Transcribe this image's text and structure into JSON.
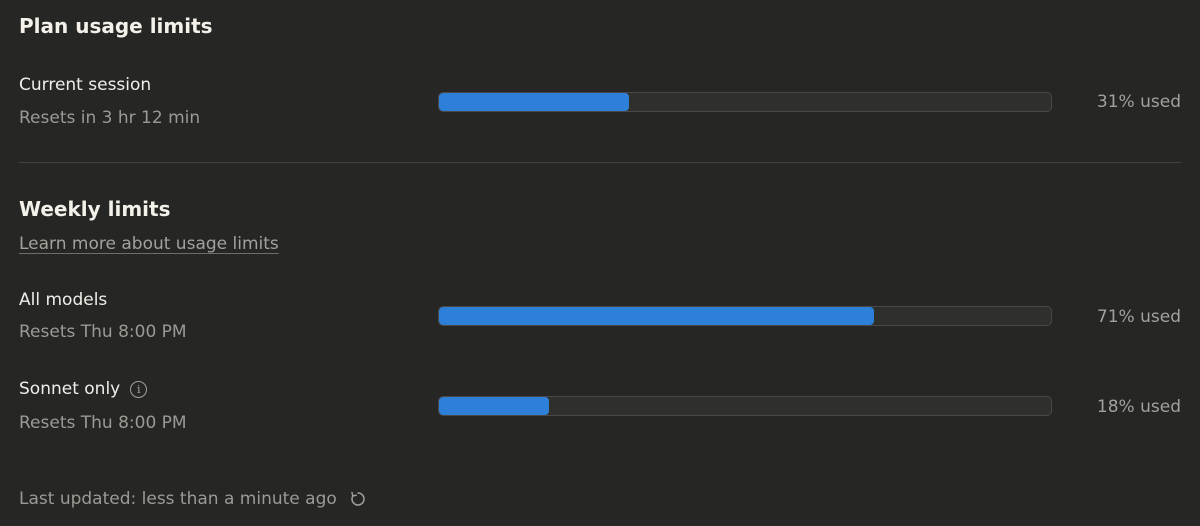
{
  "plan": {
    "title": "Plan usage limits",
    "current_session": {
      "label": "Current session",
      "resets": "Resets in 3 hr 12 min",
      "progress": 0.31,
      "used_label": "31% used"
    }
  },
  "weekly": {
    "title": "Weekly limits",
    "learn_more": "Learn more about usage limits",
    "all_models": {
      "label": "All models",
      "resets": "Resets Thu 8:00 PM",
      "progress": 0.71,
      "used_label": "71% used"
    },
    "sonnet_only": {
      "label": "Sonnet only",
      "resets": "Resets Thu 8:00 PM",
      "progress": 0.18,
      "used_label": "18% used",
      "info_icon": "info-icon"
    }
  },
  "footer": {
    "last_updated": "Last updated: less than a minute ago",
    "refresh_icon": "refresh-icon"
  },
  "colors": {
    "background": "#262624",
    "bar_fill": "#2e7fd9",
    "bar_track": "#2f2f2c"
  }
}
